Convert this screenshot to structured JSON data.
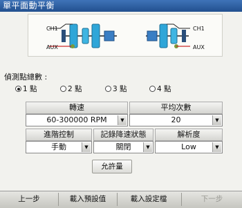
{
  "window": {
    "title": "單平面動平衡"
  },
  "diagram": {
    "ch1_label": "CH1",
    "aux_label": "AUX",
    "ch1_label_2": "CH1",
    "aux_label_2": "AUX"
  },
  "sensors": {
    "label": "偵測點總數 :",
    "options": [
      "1 點",
      "2 點",
      "3 點",
      "4 點"
    ],
    "selected": 0
  },
  "speed": {
    "header": "轉速",
    "value": "60-300000 RPM"
  },
  "average": {
    "header": "平均次數",
    "value": "20"
  },
  "advanced": {
    "header": "進階控制",
    "value": "手動"
  },
  "record": {
    "header": "記錄降速狀態",
    "value": "關閉"
  },
  "resolution": {
    "header": "解析度",
    "value": "Low"
  },
  "tolerance_button": "允許量",
  "bottom": {
    "prev": "上一步",
    "load_preset": "載入預設值",
    "load_settings": "載入設定檔",
    "next": "下一步"
  },
  "colors": {
    "title_bar": "#2f5fa3",
    "rotor": "#2fa6d8",
    "motor": "#3a7ec4",
    "disabled_text": "#9a9a94"
  }
}
